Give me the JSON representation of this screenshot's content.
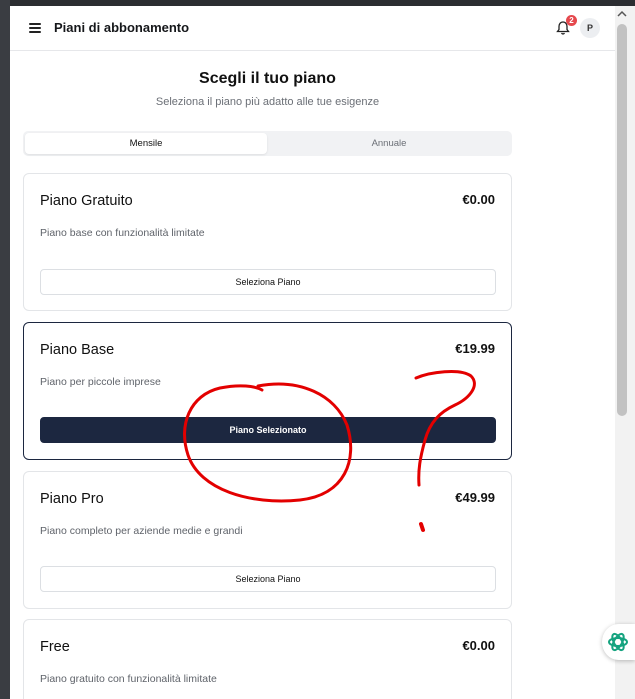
{
  "header": {
    "title": "Piani di abbonamento",
    "notification_count": "2",
    "avatar_initial": "P"
  },
  "main": {
    "title": "Scegli il tuo piano",
    "subtitle": "Seleziona il piano più adatto alle tue esigenze",
    "tabs": [
      {
        "label": "Mensile",
        "active": true
      },
      {
        "label": "Annuale",
        "active": false
      }
    ],
    "plans": [
      {
        "name": "Piano Gratuito",
        "price": "€0.00",
        "description": "Piano base con funzionalità limitate",
        "button": "Seleziona Piano",
        "selected": false
      },
      {
        "name": "Piano Base",
        "price": "€19.99",
        "description": "Piano per piccole imprese",
        "button": "Piano Selezionato",
        "selected": true
      },
      {
        "name": "Piano Pro",
        "price": "€49.99",
        "description": "Piano completo per aziende medie e grandi",
        "button": "Seleziona Piano",
        "selected": false
      },
      {
        "name": "Free",
        "price": "€0.00",
        "description": "Piano gratuito con funzionalità limitate",
        "button": "",
        "selected": false
      }
    ]
  },
  "colors": {
    "primary": "#1c2740",
    "badge": "#e5484d",
    "annotation": "#e30000"
  },
  "icons": [
    "menu-icon",
    "bell-icon",
    "assistant-icon"
  ]
}
